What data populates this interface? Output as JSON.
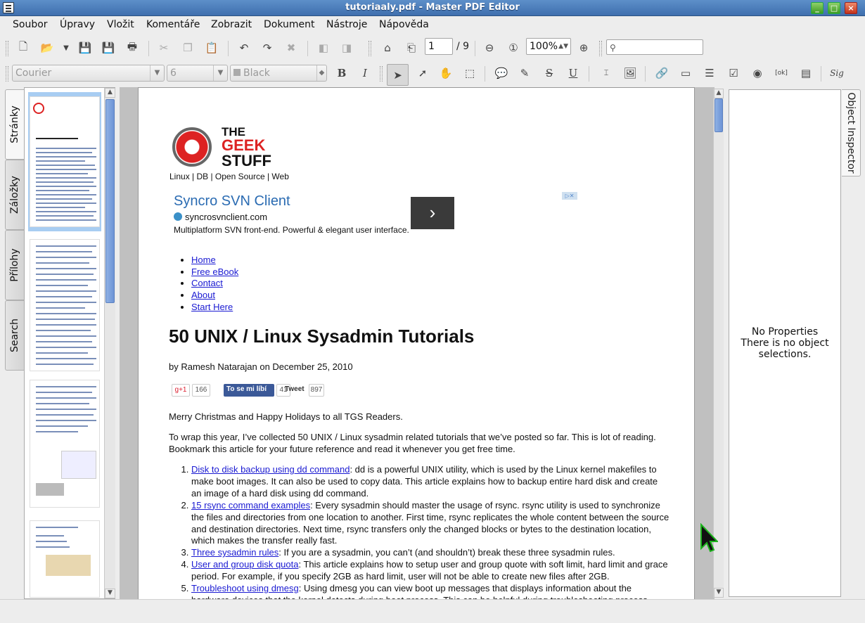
{
  "window": {
    "title": "tutoriaaly.pdf - Master PDF Editor"
  },
  "menu": [
    "Soubor",
    "Úpravy",
    "Vložit",
    "Komentáře",
    "Zobrazit",
    "Dokument",
    "Nástroje",
    "Nápověda"
  ],
  "toolbar": {
    "page_current": "1",
    "page_total": "/ 9",
    "zoom": "100%",
    "search_placeholder": ""
  },
  "format_bar": {
    "font": "Courier",
    "size": "6",
    "color": "Black",
    "bold": "B",
    "italic": "I",
    "underline": "U",
    "strike": "S",
    "signature": "Sig"
  },
  "left_tabs": [
    "Stránky",
    "Záložky",
    "Přílohy",
    "Search"
  ],
  "right_tab": "Object Inspector",
  "inspector": {
    "line1": "No Properties",
    "line2": "There is no object selections."
  },
  "document": {
    "logo": {
      "line1": "THE",
      "line2": "GEEK",
      "line3": "STUFF"
    },
    "tagline": "Linux | DB | Open Source | Web",
    "ad": {
      "title": "Syncro SVN Client",
      "url": "syncrosvnclient.com",
      "desc": "Multiplatform SVN front-end. Powerful & elegant user interface.",
      "arrow": "›"
    },
    "nav": [
      "Home",
      "Free eBook",
      "Contact",
      "About",
      "Start Here"
    ],
    "heading": "50 UNIX / Linux Sysadmin Tutorials",
    "byline": "by Ramesh Natarajan on December 25, 2010",
    "social": {
      "gplus": "g+1",
      "gplus_count": "166",
      "fb": "To se mi líbí",
      "fb_count": "41",
      "tweet": "Tweet",
      "tweet_count": "897"
    },
    "p1": "Merry Christmas and Happy Holidays to all TGS Readers.",
    "p2": "To wrap this year, I’ve collected 50 UNIX / Linux sysadmin related tutorials that we’ve posted so far. This is lot of reading. Bookmark this article for your future reference and read it whenever you get free time.",
    "items": [
      {
        "link": "Disk to disk backup using dd command",
        "text": ": dd is a powerful UNIX utility, which is used by the Linux kernel makefiles to make boot images. It can also be used to copy data. This article explains how to backup entire hard disk and create an image of a hard disk using dd command."
      },
      {
        "link": "15 rsync command examples",
        "text": ": Every sysadmin should master the usage of rsync. rsync utility is used to synchronize the files and directories from one location to another. First time, rsync replicates the whole content between the source and destination directories. Next time, rsync transfers only the changed blocks or bytes to the destination location, which makes the transfer really fast."
      },
      {
        "link": "Three sysadmin rules",
        "text": ": If you are a sysadmin, you can’t (and shouldn’t) break these three sysadmin rules."
      },
      {
        "link": "User and group disk quota",
        "text": ": This article explains how to setup user and group quote with soft limit, hard limit and grace period. For example, if you specify 2GB as hard limit, user will not be able to create new files after 2GB."
      },
      {
        "link": "Troubleshoot using dmesg",
        "text": ": Using dmesg you can view boot up messages that displays information about the hardware devices that the kernel detects during boot process. This can be helpful during troubleshooting process."
      }
    ]
  },
  "colors": {
    "title_bar": "#4a7cbc",
    "link": "#1a1ad2",
    "accent_red": "#d22222",
    "scroll_handle": "#7aa0dc"
  }
}
